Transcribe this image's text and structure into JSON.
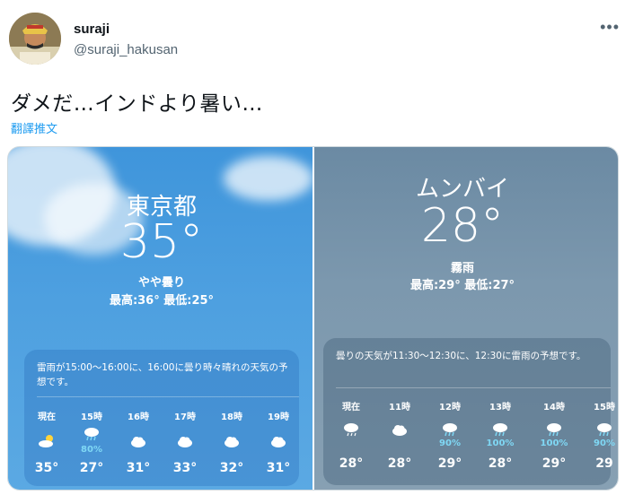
{
  "author": {
    "name": "suraji",
    "handle": "@suraji_hakusan"
  },
  "menu": {
    "more_label": "•••"
  },
  "tweet": {
    "text": "ダメだ…インドより暑い…",
    "translate_label": "翻譯推文"
  },
  "media": {
    "left": {
      "city": "東京都",
      "temperature": "35°",
      "condition": "やや曇り",
      "hilo": "最高:36° 最低:25°",
      "summary": "雷雨が15:00～16:00に、16:00に曇り時々晴れの天気の予想です。",
      "hours": [
        {
          "label": "現在",
          "icon": "partly-sunny-icon",
          "pct": "",
          "temp": "35°"
        },
        {
          "label": "15時",
          "icon": "thunder-rain-icon",
          "pct": "80%",
          "temp": "27°"
        },
        {
          "label": "16時",
          "icon": "cloud-icon",
          "pct": "",
          "temp": "31°"
        },
        {
          "label": "17時",
          "icon": "cloud-icon",
          "pct": "",
          "temp": "33°"
        },
        {
          "label": "18時",
          "icon": "cloud-icon",
          "pct": "",
          "temp": "32°"
        },
        {
          "label": "19時",
          "icon": "cloud-icon",
          "pct": "",
          "temp": "31°"
        }
      ]
    },
    "right": {
      "city": "ムンバイ",
      "temperature": "28°",
      "condition": "霧雨",
      "hilo": "最高:29° 最低:27°",
      "summary": "曇りの天気が11:30～12:30に、12:30に雷雨の予想です。",
      "hours": [
        {
          "label": "現在",
          "icon": "drizzle-icon",
          "pct": "",
          "temp": "28°"
        },
        {
          "label": "11時",
          "icon": "cloud-icon",
          "pct": "",
          "temp": "28°"
        },
        {
          "label": "12時",
          "icon": "thunder-rain-icon",
          "pct": "90%",
          "temp": "29°"
        },
        {
          "label": "13時",
          "icon": "thunder-rain-icon",
          "pct": "100%",
          "temp": "28°"
        },
        {
          "label": "14時",
          "icon": "thunder-rain-icon",
          "pct": "100%",
          "temp": "29°"
        },
        {
          "label": "15時",
          "icon": "thunder-rain-icon",
          "pct": "90%",
          "temp": "29"
        }
      ]
    }
  }
}
